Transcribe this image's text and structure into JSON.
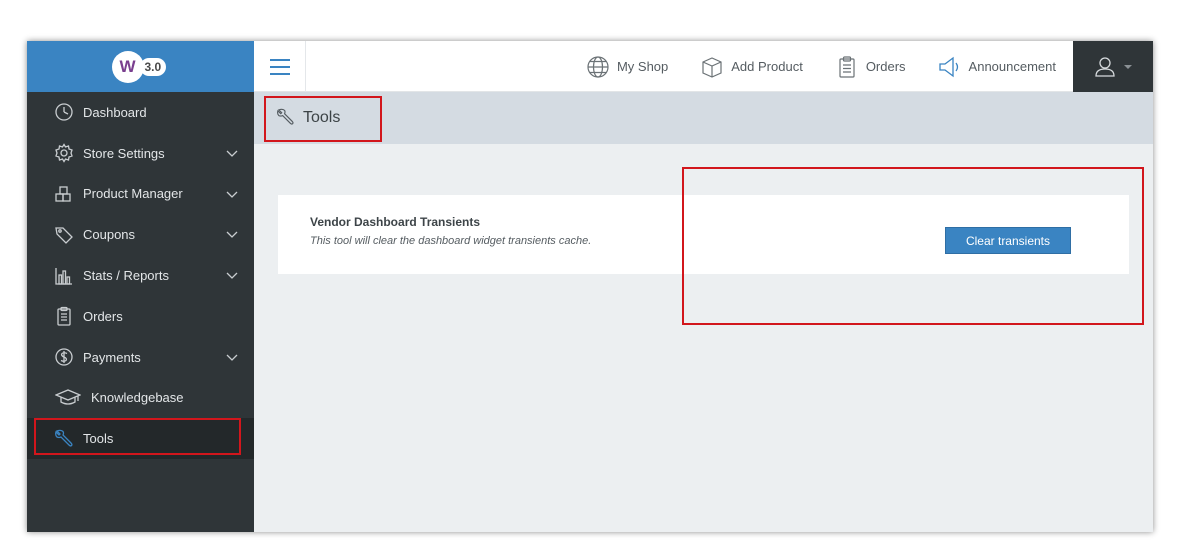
{
  "logo": {
    "mark": "W",
    "version": "3.0"
  },
  "sidebar": {
    "items": [
      {
        "label": "Dashboard",
        "icon": "dashboard-icon",
        "has_submenu": false
      },
      {
        "label": "Store Settings",
        "icon": "gear-icon",
        "has_submenu": true
      },
      {
        "label": "Product Manager",
        "icon": "boxes-icon",
        "has_submenu": true
      },
      {
        "label": "Coupons",
        "icon": "tag-icon",
        "has_submenu": true
      },
      {
        "label": "Stats / Reports",
        "icon": "bar-chart-icon",
        "has_submenu": true
      },
      {
        "label": "Orders",
        "icon": "clipboard-icon",
        "has_submenu": false
      },
      {
        "label": "Payments",
        "icon": "dollar-icon",
        "has_submenu": true
      },
      {
        "label": "Knowledgebase",
        "icon": "graduation-cap-icon",
        "has_submenu": false
      },
      {
        "label": "Tools",
        "icon": "wrench-icon",
        "has_submenu": false,
        "active": true
      }
    ]
  },
  "topbar": {
    "links": [
      {
        "label": "My Shop",
        "icon": "globe-icon"
      },
      {
        "label": "Add Product",
        "icon": "box-icon"
      },
      {
        "label": "Orders",
        "icon": "clipboard-icon"
      },
      {
        "label": "Announcement",
        "icon": "megaphone-icon"
      }
    ]
  },
  "page": {
    "title": "Tools"
  },
  "card": {
    "title": "Vendor Dashboard Transients",
    "description": "This tool will clear the dashboard widget transients cache.",
    "button_label": "Clear transients"
  },
  "colors": {
    "accent": "#3a84c2",
    "sidebar_bg": "#2f3538",
    "highlight_outline": "#d2161c"
  }
}
